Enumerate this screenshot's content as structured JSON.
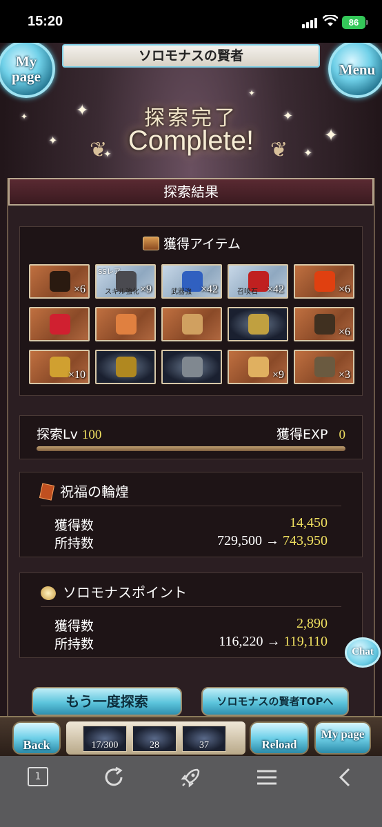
{
  "status_bar": {
    "time": "15:20",
    "battery": "86"
  },
  "header": {
    "title": "ソロモナスの賢者",
    "left_orb": "My page",
    "right_orb": "Menu"
  },
  "banner": {
    "jp": "探索完了",
    "en": "Complete!"
  },
  "results": {
    "title": "探索結果",
    "items_title": "獲得アイテム",
    "items": [
      {
        "icon": "book-icon",
        "style": "brown",
        "count": "×6"
      },
      {
        "icon": "anvil-icon",
        "style": "blue",
        "tag": "SSレア",
        "label": "スキル強化",
        "count": "×9"
      },
      {
        "icon": "chalice-blue-icon",
        "style": "blue",
        "label": "武器強",
        "count": "×42"
      },
      {
        "icon": "chalice-red-icon",
        "style": "blue",
        "label": "召喚石",
        "count": "×42"
      },
      {
        "icon": "potion-icon",
        "style": "brown",
        "count": "×6"
      },
      {
        "icon": "red-gem-icon",
        "style": "brown",
        "count": ""
      },
      {
        "icon": "earrings-icon",
        "style": "brown",
        "count": ""
      },
      {
        "icon": "hourglass-icon",
        "style": "brown",
        "count": ""
      },
      {
        "icon": "gear-ornament-icon",
        "style": "dark",
        "count": ""
      },
      {
        "icon": "medallion-icon",
        "style": "brown",
        "count": "×6"
      },
      {
        "icon": "gold-coin-icon",
        "style": "brown",
        "count": "×10"
      },
      {
        "icon": "gold-cube-icon",
        "style": "dark",
        "count": ""
      },
      {
        "icon": "silver-cube-icon",
        "style": "dark",
        "count": ""
      },
      {
        "icon": "orb-icon",
        "style": "brown",
        "count": "×9"
      },
      {
        "icon": "cog-icon",
        "style": "brown",
        "count": "×3"
      }
    ],
    "lv_label": "探索Lv",
    "lv_value": "100",
    "exp_label": "獲得EXP",
    "exp_value": "0",
    "exp_progress": 1.0,
    "currencies": [
      {
        "name": "祝福の輪煌",
        "icon": "card-icon",
        "gained_label": "獲得数",
        "gained": "14,450",
        "owned_label": "所持数",
        "owned_before": "729,500",
        "owned_after": "743,950"
      },
      {
        "name": "ソロモナスポイント",
        "icon": "star-point-icon",
        "gained_label": "獲得数",
        "gained": "2,890",
        "owned_label": "所持数",
        "owned_before": "116,220",
        "owned_after": "119,110"
      }
    ]
  },
  "buttons": {
    "again": "もう一度探索",
    "top": "ソロモナスの賢者TOPへ",
    "chat": "Chat"
  },
  "bottom_nav": {
    "back": "Back",
    "slots": [
      "17/300",
      "28",
      "37"
    ],
    "reload": "Reload",
    "mypage": "My page"
  },
  "browser": {
    "tabs": "1"
  }
}
